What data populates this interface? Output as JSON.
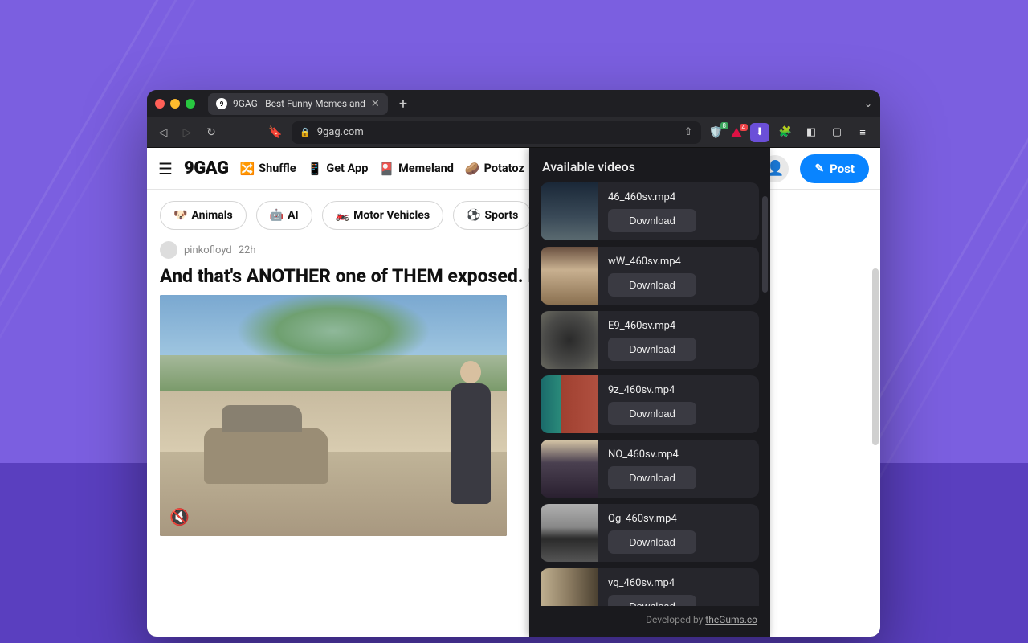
{
  "browser": {
    "tab_title": "9GAG - Best Funny Memes and",
    "url": "9gag.com",
    "shield_badge": "8",
    "triangle_badge": "4"
  },
  "site": {
    "logo": "9GAG",
    "nav": [
      {
        "emoji": "🔀",
        "label": "Shuffle"
      },
      {
        "emoji": "📱",
        "label": "Get App"
      },
      {
        "emoji": "🎴",
        "label": "Memeland"
      },
      {
        "emoji": "🥔",
        "label": "Potatoz"
      }
    ],
    "post_btn": "Post",
    "chips": [
      {
        "emoji": "🐶",
        "label": "Animals"
      },
      {
        "emoji": "🤖",
        "label": "AI"
      },
      {
        "emoji": "🏍️",
        "label": "Motor Vehicles"
      },
      {
        "emoji": "⚽",
        "label": "Sports"
      }
    ],
    "post_meta_user": "pinkofloyd",
    "post_meta_time": "22h",
    "post_title": "And that's ANOTHER one of THEM exposed. D"
  },
  "popup": {
    "title": "Available videos",
    "download_label": "Download",
    "videos": [
      {
        "filename": "46_460sv.mp4"
      },
      {
        "filename": "wW_460sv.mp4"
      },
      {
        "filename": "E9_460sv.mp4"
      },
      {
        "filename": "9z_460sv.mp4"
      },
      {
        "filename": "NO_460sv.mp4"
      },
      {
        "filename": "Qg_460sv.mp4"
      },
      {
        "filename": "vq_460sv.mp4"
      }
    ],
    "footer_prefix": "Developed by ",
    "footer_link": "theGums.co"
  }
}
